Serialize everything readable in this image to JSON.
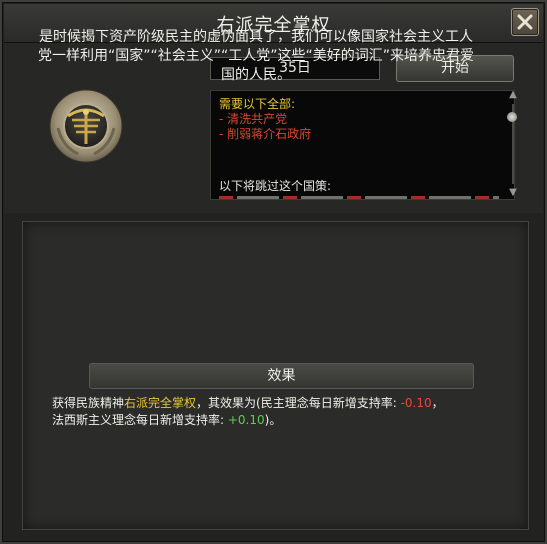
{
  "window": {
    "title": "右派完全掌权",
    "close_icon": "close-x-icon"
  },
  "focus": {
    "icon": "medal-emblem-icon",
    "days": "35日",
    "start_label": "开始"
  },
  "requirements": {
    "header": "需要以下全部:",
    "items": [
      "- 清洗共产党",
      "- 削弱蒋介石政府"
    ],
    "bypass": "以下将跳过这个国策:"
  },
  "description": {
    "text": "是时候揭下资产阶级民主的虚伪面具了，我们可以像国家社会主义工人党一样利用“国家”“社会主义”“工人党”这些“美好的词汇”来培养忠君爱国的人民。"
  },
  "effects": {
    "header": "效果",
    "line1_prefix": "获得民族精神",
    "spirit_name": "右派完全掌权",
    "line1_mid": "，其效果为(民主理念每日新增支持率: ",
    "democracy_value": "-0.10",
    "line1_suffix": "，",
    "line2_prefix": "法西斯主义理念每日新增支持率: ",
    "fascism_value": "+0.10",
    "line2_suffix": ")。"
  },
  "colors": {
    "accent_yellow": "#e8c63a",
    "negative_red": "#e24a3a",
    "positive_green": "#5bd04a"
  }
}
